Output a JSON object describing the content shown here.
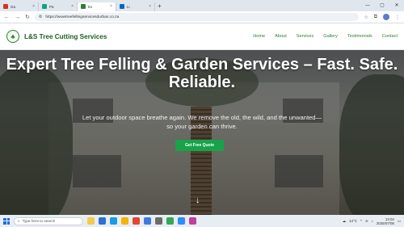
{
  "browser": {
    "tabs": [
      {
        "label": "Ga",
        "favicon": "gmail-icon",
        "color": "#d93025"
      },
      {
        "label": "Pa",
        "favicon": "chatgpt-icon",
        "color": "#10a37f"
      },
      {
        "label": "Ex",
        "favicon": "site-icon",
        "color": "#2e7d32",
        "active": true
      },
      {
        "label": "Li",
        "favicon": "linkedin-icon",
        "color": "#0a66c2"
      }
    ],
    "url": "https://wwwtreefellingservicesdurban.co.za"
  },
  "site": {
    "brand": "L&S Tree Cutting Services",
    "menu": [
      "Home",
      "About",
      "Services",
      "Gallery",
      "Testimonials",
      "Contact"
    ]
  },
  "hero": {
    "title": "Expert Tree Felling & Garden Services – Fast. Safe. Reliable.",
    "subtitle": "Let your outdoor space breathe again. We remove the old, the wild, and the unwanted—so your garden can thrive.",
    "cta": "Get Free Quote"
  },
  "taskbar": {
    "search_placeholder": "Type here to search",
    "time": "13:04",
    "date": "2025/07/08",
    "weather": "14°C"
  },
  "colors": {
    "brand": "#1b5e20",
    "cta": "#17a34a"
  }
}
